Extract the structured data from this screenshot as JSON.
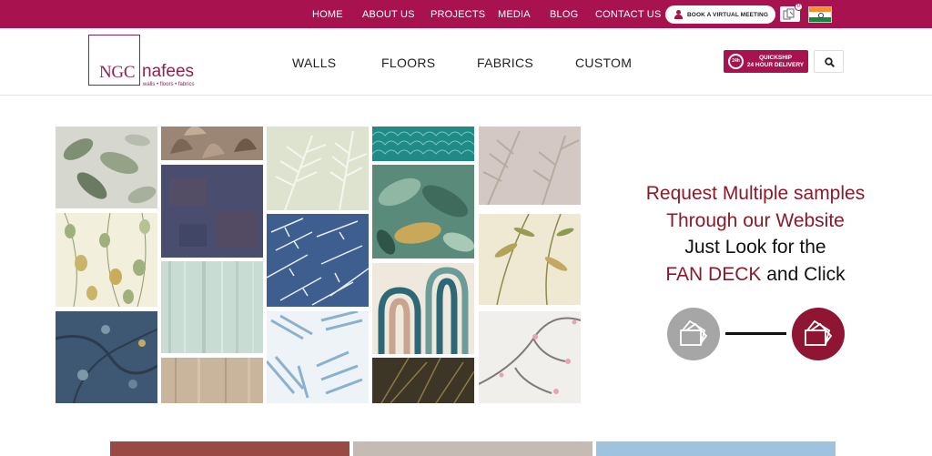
{
  "topbar": {
    "nav": [
      "HOME",
      "ABOUT US",
      "PROJECTS",
      "MEDIA",
      "BLOG",
      "CONTACT US"
    ],
    "meeting_label": "BOOK A VIRTUAL MEETING",
    "sample_count": "0",
    "brand_color": "#a8134f"
  },
  "header": {
    "logo_ngc": "NGC",
    "logo_nafees": "nafees",
    "logo_tagline": "walls • floors • fabrics",
    "nav": [
      "WALLS",
      "FLOORS",
      "FABRICS",
      "CUSTOM"
    ],
    "quickship_line1": "QUICKSHIP",
    "quickship_line2": "24 HOUR DELIVERY",
    "quickship_badge": "24h",
    "search_icon": "search-icon"
  },
  "hero": {
    "promo_line1": "Request Multiple samples",
    "promo_line2": "Through our Website",
    "promo_line3": "Just Look for the",
    "promo_line4_highlight": "FAN DECK",
    "promo_line4_rest": " and Click",
    "highlight_color": "#8a1a2a",
    "icons": [
      "fan-deck-grey-icon",
      "fan-deck-red-icon"
    ]
  }
}
